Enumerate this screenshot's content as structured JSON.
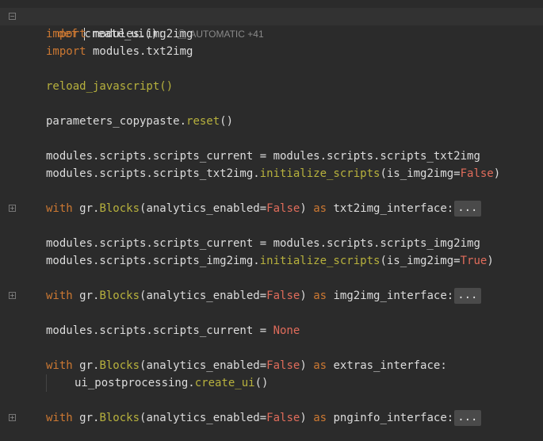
{
  "editor": {
    "def_keyword": "def",
    "def_name": "create_ui",
    "def_tail": "():",
    "author_icon": "person-icon",
    "author_label": "AUTOMATIC +41",
    "fold_placeholder": "...",
    "lines": {
      "l2": {
        "kw": "import",
        "rest": " modules.img2img"
      },
      "l3": {
        "kw": "import",
        "rest": " modules.txt2img"
      },
      "l5": {
        "fn": "reload_javascript",
        "tail": "()"
      },
      "l7": {
        "pre": "parameters_copypaste.",
        "fn": "reset",
        "tail": "()"
      },
      "l9": {
        "text": "modules.scripts.scripts_current = modules.scripts.scripts_txt2img"
      },
      "l10": {
        "pre": "modules.scripts.scripts_txt2img.",
        "fn": "initialize_scripts",
        "mid": "(is_img2img=",
        "bool": "False",
        "tail": ")"
      },
      "l12": {
        "kw": "with",
        "pre": " gr.",
        "fn": "Blocks",
        "mid": "(analytics_enabled=",
        "bool": "False",
        "close": ") ",
        "kw2": "as",
        "tail": " txt2img_interface:"
      },
      "l14": {
        "text": "modules.scripts.scripts_current = modules.scripts.scripts_img2img"
      },
      "l15": {
        "pre": "modules.scripts.scripts_img2img.",
        "fn": "initialize_scripts",
        "mid": "(is_img2img=",
        "bool": "True",
        "tail": ")"
      },
      "l17": {
        "kw": "with",
        "pre": " gr.",
        "fn": "Blocks",
        "mid": "(analytics_enabled=",
        "bool": "False",
        "close": ") ",
        "kw2": "as",
        "tail": " img2img_interface:"
      },
      "l19": {
        "pre": "modules.scripts.scripts_current = ",
        "bool": "None"
      },
      "l21": {
        "kw": "with",
        "pre": " gr.",
        "fn": "Blocks",
        "mid": "(analytics_enabled=",
        "bool": "False",
        "close": ") ",
        "kw2": "as",
        "tail": " extras_interface:"
      },
      "l22": {
        "pre": "ui_postprocessing.",
        "fn": "create_ui",
        "tail": "()"
      },
      "l24": {
        "kw": "with",
        "pre": " gr.",
        "fn": "Blocks",
        "mid": "(analytics_enabled=",
        "bool": "False",
        "close": ") ",
        "kw2": "as",
        "tail": " pnginfo_interface:"
      }
    }
  }
}
